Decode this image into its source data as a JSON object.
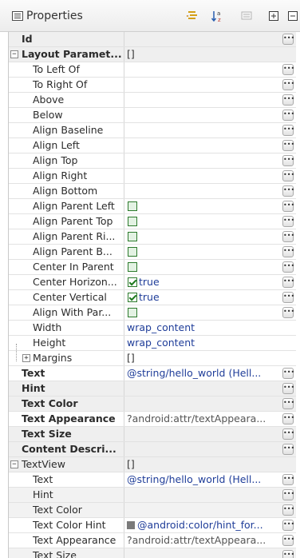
{
  "header": {
    "title": "Properties",
    "icons": [
      "properties-view-icon",
      "show-categories-icon",
      "sort-alphabetically-icon",
      "show-advanced-icon",
      "expand-all-icon",
      "collapse-all-icon"
    ]
  },
  "rows": [
    {
      "name": "Id",
      "indent": 0,
      "bold": true,
      "expander": "",
      "value": "",
      "edit": true,
      "style": "cat"
    },
    {
      "name": "Layout Paramet...",
      "indent": 0,
      "bold": true,
      "expander": "−",
      "value": "[]",
      "edit": false,
      "style": "cat"
    },
    {
      "name": "To Left Of",
      "indent": 2,
      "value": "",
      "edit": true
    },
    {
      "name": "To Right Of",
      "indent": 2,
      "value": "",
      "edit": true
    },
    {
      "name": "Above",
      "indent": 2,
      "value": "",
      "edit": true
    },
    {
      "name": "Below",
      "indent": 2,
      "value": "",
      "edit": true
    },
    {
      "name": "Align Baseline",
      "indent": 2,
      "value": "",
      "edit": true
    },
    {
      "name": "Align Left",
      "indent": 2,
      "value": "",
      "edit": true
    },
    {
      "name": "Align Top",
      "indent": 2,
      "value": "",
      "edit": true
    },
    {
      "name": "Align Right",
      "indent": 2,
      "value": "",
      "edit": true
    },
    {
      "name": "Align Bottom",
      "indent": 2,
      "value": "",
      "edit": true
    },
    {
      "name": "Align Parent Left",
      "indent": 2,
      "checkbox": "unchecked",
      "value": "",
      "edit": true
    },
    {
      "name": "Align Parent Top",
      "indent": 2,
      "checkbox": "unchecked",
      "value": "",
      "edit": true
    },
    {
      "name": "Align Parent Ri...",
      "indent": 2,
      "checkbox": "unchecked",
      "value": "",
      "edit": true
    },
    {
      "name": "Align Parent B...",
      "indent": 2,
      "checkbox": "unchecked",
      "value": "",
      "edit": true
    },
    {
      "name": "Center In Parent",
      "indent": 2,
      "checkbox": "unchecked",
      "value": "",
      "edit": true
    },
    {
      "name": "Center Horizon...",
      "indent": 2,
      "checkbox": "checked",
      "value": "true",
      "edit": true
    },
    {
      "name": "Center Vertical",
      "indent": 2,
      "checkbox": "checked",
      "value": "true",
      "edit": true
    },
    {
      "name": "Align With Par...",
      "indent": 2,
      "checkbox": "unchecked",
      "value": "",
      "edit": true
    },
    {
      "name": "Width",
      "indent": 2,
      "value": "wrap_content",
      "valstyle": "link",
      "edit": false
    },
    {
      "name": "Height",
      "indent": 2,
      "value": "wrap_content",
      "valstyle": "link",
      "edit": false
    },
    {
      "name": "Margins",
      "indent": 1,
      "expander": "+",
      "value": "[]",
      "edit": false
    },
    {
      "name": "Text",
      "indent": 0,
      "bold": true,
      "value": "@string/hello_world (Hell...",
      "valstyle": "link",
      "edit": true,
      "style": "sel"
    },
    {
      "name": "Hint",
      "indent": 0,
      "bold": true,
      "value": "",
      "edit": true,
      "style": "cat"
    },
    {
      "name": "Text Color",
      "indent": 0,
      "bold": true,
      "value": "",
      "edit": true,
      "style": "cat"
    },
    {
      "name": "Text Appearance",
      "indent": 0,
      "bold": true,
      "value": "?android:attr/textAppeara...",
      "valstyle": "grey",
      "edit": true,
      "style": "sel"
    },
    {
      "name": "Text Size",
      "indent": 0,
      "bold": true,
      "value": "",
      "edit": true,
      "style": "cat"
    },
    {
      "name": "Content Descri...",
      "indent": 0,
      "bold": true,
      "value": "",
      "edit": true,
      "style": "cat"
    },
    {
      "name": "TextView",
      "indent": 0,
      "expander": "−",
      "value": "[]",
      "edit": false,
      "style": "cat"
    },
    {
      "name": "Text",
      "indent": 2,
      "value": "@string/hello_world (Hell...",
      "valstyle": "link",
      "edit": true,
      "style": "sel"
    },
    {
      "name": "Hint",
      "indent": 2,
      "value": "",
      "edit": true,
      "style": "gray"
    },
    {
      "name": "Text Color",
      "indent": 2,
      "value": "",
      "edit": true,
      "style": "gray"
    },
    {
      "name": "Text Color Hint",
      "indent": 2,
      "value": "@android:color/hint_for...",
      "valstyle": "link",
      "swatch": true,
      "edit": true,
      "style": "sel"
    },
    {
      "name": "Text Appearance",
      "indent": 2,
      "value": "?android:attr/textAppeara...",
      "valstyle": "grey",
      "edit": true,
      "style": "sel"
    },
    {
      "name": "Text Size",
      "indent": 2,
      "value": "",
      "edit": true,
      "style": "gray"
    }
  ]
}
